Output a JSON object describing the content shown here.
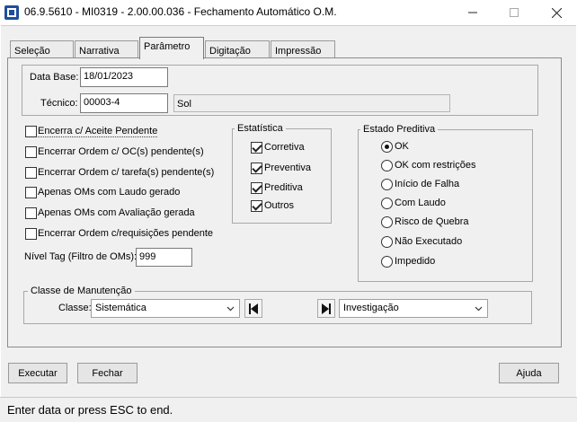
{
  "window": {
    "title": "06.9.5610 - MI0319 - 2.00.00.036 - Fechamento Automático O.M.",
    "icon": "app-logo-icon"
  },
  "tabs": [
    {
      "label": "Seleção",
      "active": false
    },
    {
      "label": "Narrativa",
      "active": false
    },
    {
      "label": "Parâmetro",
      "active": true
    },
    {
      "label": "Digitação",
      "active": false
    },
    {
      "label": "Impressão",
      "active": false
    }
  ],
  "params": {
    "data_base_label": "Data Base:",
    "data_base_value": "18/01/2023",
    "tecnico_label": "Técnico:",
    "tecnico_value": "00003-4",
    "tecnico_name": "Sol"
  },
  "options": [
    {
      "label": "Encerra c/ Aceite Pendente",
      "checked": false
    },
    {
      "label": "Encerrar Ordem c/ OC(s) pendente(s)",
      "checked": false
    },
    {
      "label": "Encerrar Ordem c/ tarefa(s) pendente(s)",
      "checked": false
    },
    {
      "label": "Apenas OMs com Laudo gerado",
      "checked": false
    },
    {
      "label": "Apenas OMs com Avaliação gerada",
      "checked": false
    },
    {
      "label": "Encerrar Ordem c/requisições pendente",
      "checked": false
    }
  ],
  "nivel_tag": {
    "label": "Nível Tag (Filtro de OMs):",
    "value": "999"
  },
  "estatistica": {
    "title": "Estatística",
    "items": [
      {
        "label": "Corretiva",
        "checked": true
      },
      {
        "label": "Preventiva",
        "checked": true
      },
      {
        "label": "Preditiva",
        "checked": true
      },
      {
        "label": "Outros",
        "checked": true
      }
    ]
  },
  "estado_preditiva": {
    "title": "Estado Preditiva",
    "items": [
      {
        "label": "OK",
        "selected": true
      },
      {
        "label": "OK com restrições",
        "selected": false
      },
      {
        "label": "Início de Falha",
        "selected": false
      },
      {
        "label": "Com Laudo",
        "selected": false
      },
      {
        "label": "Risco de Quebra",
        "selected": false
      },
      {
        "label": "Não Executado",
        "selected": false
      },
      {
        "label": "Impedido",
        "selected": false
      }
    ]
  },
  "classe": {
    "title": "Classe de Manutenção",
    "label": "Classe:",
    "from_value": "Sistemática",
    "to_value": "Investigação"
  },
  "buttons": {
    "executar": "Executar",
    "fechar": "Fechar",
    "ajuda": "Ajuda"
  },
  "status": "Enter data or press ESC to end.",
  "colors": {
    "window_bg": "#f0f0f0",
    "input_bg": "#ffffff",
    "readonly_bg": "#eeeeee",
    "logo_blue": "#1f4e9c"
  }
}
